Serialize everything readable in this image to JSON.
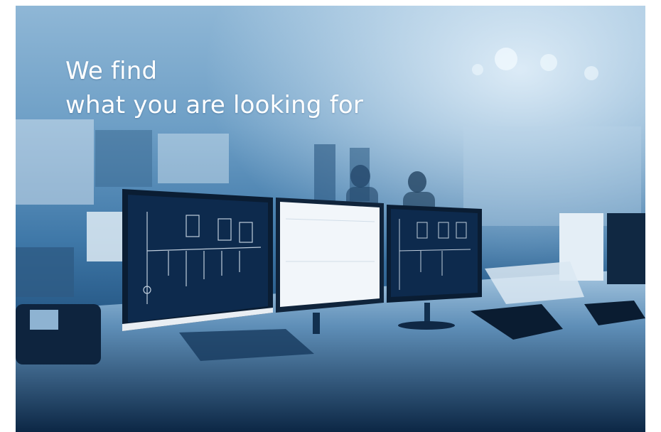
{
  "hero": {
    "headline_line1": "We find",
    "headline_line2": "what you are looking for"
  },
  "colors": {
    "tint_light": "#8fb7d6",
    "tint_mid": "#3f78a8",
    "tint_dark": "#0f2e4f",
    "screen_dark": "#0d2a4d",
    "screen_light": "#f2f6fa"
  },
  "image": {
    "subject": "control-room-monitors"
  }
}
